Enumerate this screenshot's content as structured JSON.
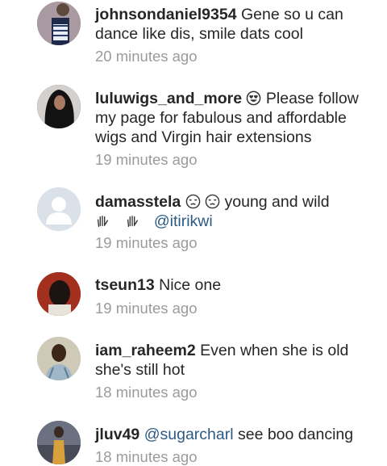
{
  "comments": [
    {
      "username": "johnsondaniel9354",
      "text": "Gene so u can dance like dis, smile dats cool",
      "time": "20 minutes ago"
    },
    {
      "username": "luluwigs_and_more",
      "emoji": "heart-eyes",
      "text": "Please follow my page for fabulous and affordable wigs and Virgin hair extensions",
      "time": "19 minutes ago"
    },
    {
      "username": "damasstela",
      "emoji": "unamused-face x2, raised-hand x2",
      "text": "young and wild",
      "mention": "@itirikwi",
      "time": "19 minutes ago"
    },
    {
      "username": "tseun13",
      "text": "Nice one",
      "time": "19 minutes ago"
    },
    {
      "username": "iam_raheem2",
      "text": "Even when she is old she's still hot",
      "time": "18 minutes ago"
    },
    {
      "username": "jluv49",
      "mention": "@sugarcharl",
      "text": "see boo dancing",
      "time": "18 minutes ago"
    }
  ]
}
